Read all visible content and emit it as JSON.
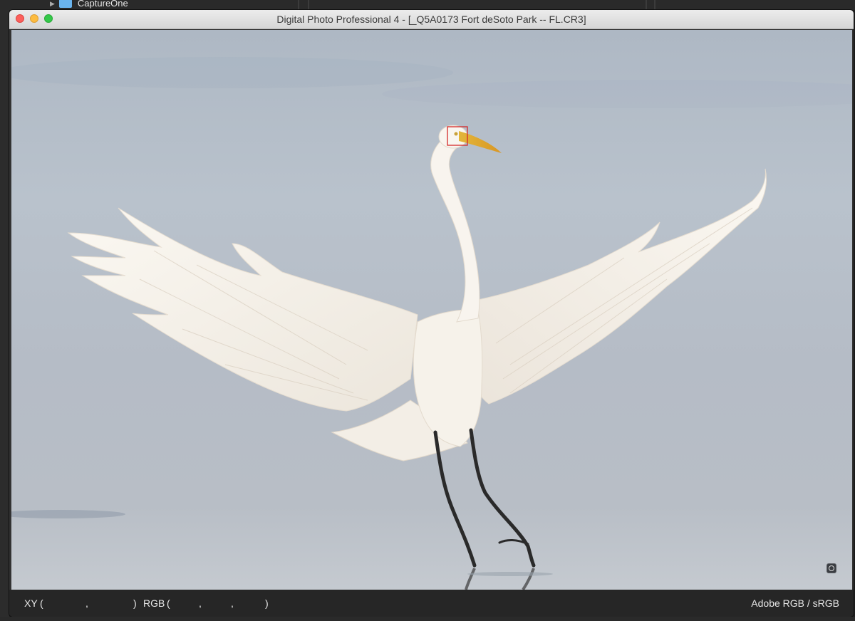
{
  "background_app": {
    "folder_name": "CaptureOne"
  },
  "window": {
    "title": "Digital Photo Professional 4 - [_Q5A0173 Fort deSoto Park -- FL.CR3]"
  },
  "status_bar": {
    "xy_label": "XY",
    "xy_open": "(",
    "xy_sep": ",",
    "xy_close": ")",
    "rgb_label": "RGB",
    "rgb_open": "(",
    "rgb_sep1": ",",
    "rgb_sep2": ",",
    "rgb_close": ")",
    "color_profile": "Adobe RGB / sRGB"
  },
  "icons": {
    "close": "close-button",
    "minimize": "minimize-button",
    "zoom": "zoom-button",
    "fit": "fit-view-icon"
  },
  "colors": {
    "close": "#fc605c",
    "minimize": "#fdbc40",
    "zoom": "#34c84a",
    "focus_point": "#d42a2a"
  }
}
